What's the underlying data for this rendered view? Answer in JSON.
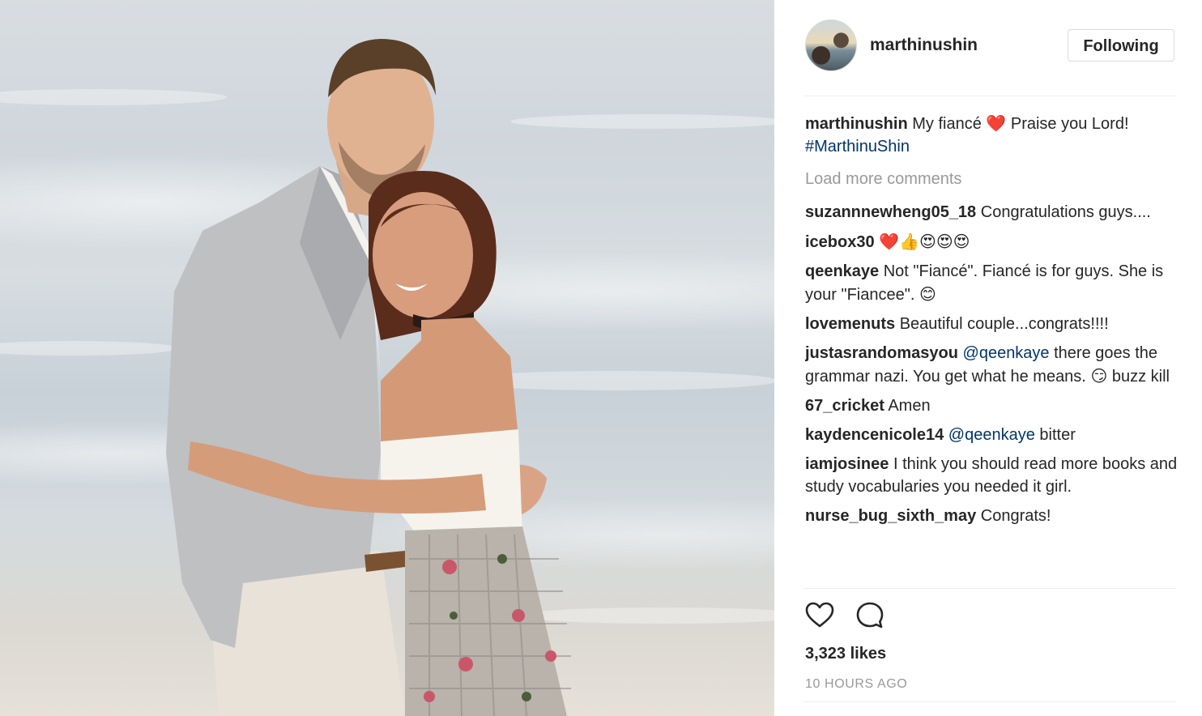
{
  "post": {
    "header": {
      "username": "marthinushin",
      "follow_label": "Following"
    },
    "caption": {
      "username": "marthinushin",
      "text": "My fiancé",
      "emoji": "❤️",
      "text2": "Praise you Lord!",
      "hashtag": "#MarthinuShin"
    },
    "load_more_label": "Load more comments",
    "comments": [
      {
        "user": "suzannnewheng05_18",
        "text": "Congratulations guys...."
      },
      {
        "user": "icebox30",
        "text": "❤️👍😍😍😍"
      },
      {
        "user": "qeenkaye",
        "text": "Not \"Fiancé\". Fiancé is for guys. She is your \"Fiancee\".",
        "emoji": "😊"
      },
      {
        "user": "lovemenuts",
        "text": "Beautiful couple...congrats!!!!"
      },
      {
        "user": "justasrandomasyou",
        "mention": "@qeenkaye",
        "text": "there goes the grammar nazi. You get what he means.",
        "emoji": "😏",
        "text2": "buzz kill"
      },
      {
        "user": "67_cricket",
        "text": "Amen"
      },
      {
        "user": "kaydencenicole14",
        "mention": "@qeenkaye",
        "text": "bitter"
      },
      {
        "user": "iamjosinee",
        "text": "I think you should read more books and study vocabularies you needed it girl."
      },
      {
        "user": "nurse_bug_sixth_may",
        "text": "Congrats!"
      }
    ],
    "likes_label": "3,323 likes",
    "time_label": "10 HOURS AGO",
    "icons": [
      "heart-outline-icon",
      "comment-bubble-icon"
    ]
  }
}
